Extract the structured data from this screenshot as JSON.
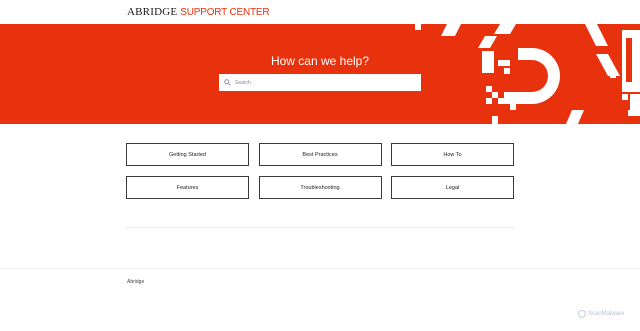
{
  "header": {
    "brand": "ABRIDGE",
    "subtitle": "SUPPORT CENTER"
  },
  "hero": {
    "title": "How can we help?",
    "search_placeholder": "Search"
  },
  "categories": [
    "Getting Started",
    "Best Practices",
    "How To",
    "Features",
    "Troubleshooting",
    "Legal"
  ],
  "footer": {
    "text": "Abridge"
  },
  "watermark": {
    "text": "ScanMalware"
  },
  "colors": {
    "accent": "#e8320e",
    "background": "#ffffff"
  }
}
